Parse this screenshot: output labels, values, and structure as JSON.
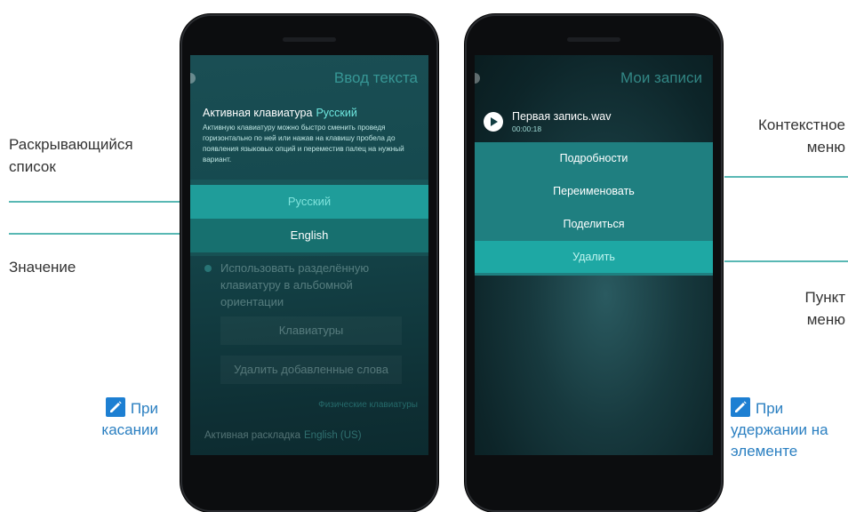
{
  "annotations": {
    "dropdown_label": "Раскрывающийся список",
    "value_label": "Значение",
    "tap_hint": "При касании",
    "context_menu_label": "Контекстное меню",
    "menu_item_label": "Пункт меню",
    "hold_hint": "При удержании на элементе"
  },
  "left_phone": {
    "page_title": "Ввод текста",
    "active_keyboard_label": "Активная клавиатура",
    "active_keyboard_value": "Русский",
    "description": "Активную клавиатуру можно быстро сменить проведя горизонтально по ней или нажав на клавишу пробела до появления языковых опций и переместив палец на нужный вариант.",
    "options": [
      "Русский",
      "English"
    ],
    "split_keyboard_text": "Использовать разделённую клавиатуру в альбомной ориентации",
    "keyboards_button": "Клавиатуры",
    "delete_words_button": "Удалить добавленные слова",
    "physical_keyboards_link": "Физические клавиатуры",
    "active_layout_label": "Активная раскладка",
    "active_layout_value": "English (US)"
  },
  "right_phone": {
    "page_title": "Мои записи",
    "recording_title": "Первая запись.wav",
    "recording_time": "00:00:18",
    "menu_items": [
      "Подробности",
      "Переименовать",
      "Поделиться",
      "Удалить"
    ]
  },
  "colors": {
    "accent": "#59b8b4",
    "hint_blue": "#2a7fc1",
    "highlight": "#1ea8a4"
  },
  "icons": [
    "pen-edit-icon",
    "play-icon"
  ]
}
